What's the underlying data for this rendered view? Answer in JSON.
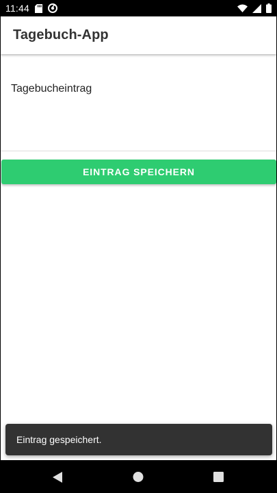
{
  "status_bar": {
    "time": "11:44",
    "icons": [
      "sd-card-icon",
      "sync-icon",
      "wifi-icon",
      "signal-icon",
      "battery-icon"
    ]
  },
  "app_bar": {
    "title": "Tagebuch-App"
  },
  "entry": {
    "text": "Tagebucheintrag"
  },
  "save_button": {
    "label": "EINTRAG SPEICHERN",
    "color": "#2ecc71"
  },
  "snackbar": {
    "message": "Eintrag gespeichert."
  },
  "nav_bar": {
    "buttons": [
      "back-icon",
      "home-icon",
      "recents-icon"
    ]
  }
}
